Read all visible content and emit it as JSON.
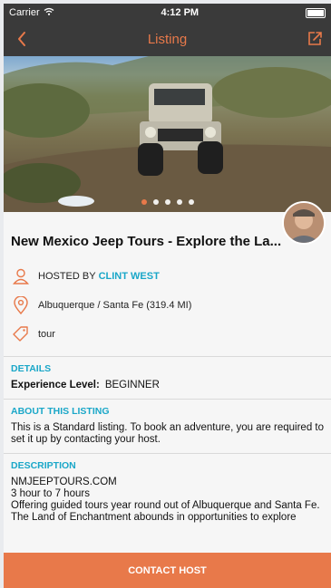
{
  "status_bar": {
    "carrier": "Carrier",
    "time": "4:12 PM"
  },
  "nav": {
    "title": "Listing"
  },
  "listing": {
    "title": "New Mexico Jeep Tours - Explore the La...",
    "hosted_by_label": "HOSTED BY",
    "host_name": "CLINT WEST",
    "location": "Albuquerque / Santa Fe (319.4 MI)",
    "tag": "tour",
    "carousel": {
      "slide_count": 5,
      "active_index": 0
    }
  },
  "details": {
    "heading": "DETAILS",
    "experience_label": "Experience Level:",
    "experience_value": "BEGINNER"
  },
  "about": {
    "heading": "ABOUT THIS LISTING",
    "text": "This is a Standard listing. To book an adventure, you are required to set it up by contacting your host."
  },
  "description": {
    "heading": "DESCRIPTION",
    "lines": [
      "NMJEEPTOURS.COM",
      "3 hour to 7 hours",
      "Offering guided tours year round out of Albuquerque and Santa Fe.",
      "The Land of Enchantment abounds in opportunities to explore"
    ]
  },
  "actions": {
    "contact_label": "CONTACT HOST"
  },
  "colors": {
    "accent": "#e8794a",
    "link": "#1aa7c8",
    "bar": "#3a3a3a"
  }
}
